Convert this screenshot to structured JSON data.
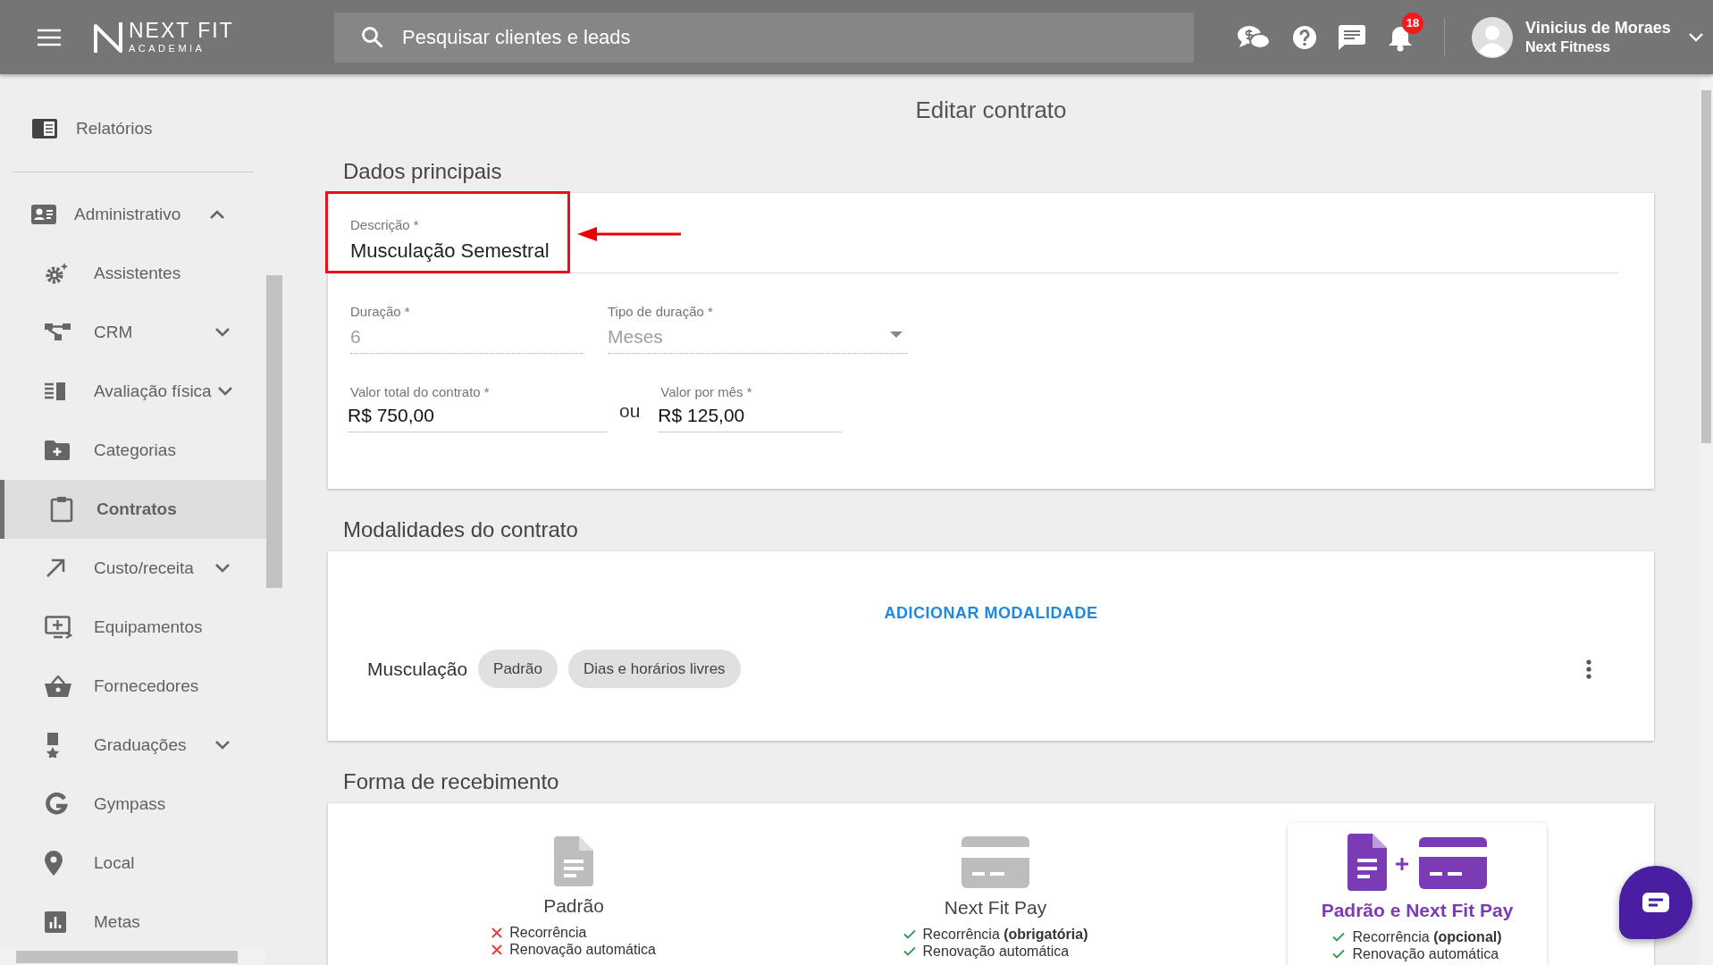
{
  "top_bar": {
    "logo": {
      "name": "NEXT FIT",
      "subtitle": "ACADEMIA"
    },
    "search": {
      "placeholder": "Pesquisar clientes e leads"
    },
    "notification_count": "18",
    "user": {
      "name": "Vinicius de Moraes",
      "company": "Next Fitness"
    }
  },
  "sidebar": {
    "items": [
      {
        "label": "Relatórios",
        "selected": false
      },
      {
        "label": "Administrativo",
        "selected": false,
        "expanded": true,
        "children": [
          {
            "label": "Assistentes",
            "selected": false
          },
          {
            "label": "CRM",
            "selected": false,
            "expanded": false
          },
          {
            "label": "Avaliação física",
            "selected": false,
            "expanded": false
          },
          {
            "label": "Categorias",
            "selected": false
          },
          {
            "label": "Contratos",
            "selected": true
          },
          {
            "label": "Custo/receita",
            "selected": false,
            "expanded": false
          },
          {
            "label": "Equipamentos",
            "selected": false
          },
          {
            "label": "Fornecedores",
            "selected": false
          },
          {
            "label": "Graduações",
            "selected": false,
            "expanded": false
          },
          {
            "label": "Gympass",
            "selected": false
          },
          {
            "label": "Local",
            "selected": false
          },
          {
            "label": "Metas",
            "selected": false
          }
        ]
      }
    ]
  },
  "page_title": "Editar contrato",
  "main_data": {
    "heading": "Dados principais",
    "description": {
      "label": "Descrição *",
      "value": "Musculação Semestral",
      "highlighted": true
    },
    "duration": {
      "label": "Duração *",
      "value": "6",
      "disabled": true
    },
    "duration_type": {
      "label": "Tipo de duração *",
      "value": "Meses",
      "disabled": true
    },
    "total_value": {
      "label": "Valor total do contrato *",
      "value": "R$ 750,00"
    },
    "separator": "ou",
    "monthly_value": {
      "label": "Valor por mês *",
      "value": "R$ 125,00"
    }
  },
  "modalities": {
    "heading": "Modalidades do contrato",
    "add_button": "ADICIONAR MODALIDADE",
    "items": [
      {
        "name": "Musculação",
        "tags": [
          "Padrão",
          "Dias e horários livres"
        ]
      }
    ]
  },
  "payment": {
    "heading": "Forma de recebimento",
    "options": [
      {
        "kind": "standard",
        "title": "Padrão",
        "selected": false,
        "features": [
          {
            "text": "Recorrência",
            "available": false
          },
          {
            "text": "Renovação automática",
            "available": false
          }
        ]
      },
      {
        "kind": "pay",
        "title": "Next Fit Pay",
        "selected": false,
        "features": [
          {
            "text": "Recorrência **(obrigatória)**",
            "available": true
          },
          {
            "text": "Renovação automática",
            "available": true
          }
        ]
      },
      {
        "kind": "both",
        "title": "Padrão e Next Fit Pay",
        "selected": true,
        "features": [
          {
            "text": "Recorrência **(opcional)**",
            "available": true
          },
          {
            "text": "Renovação automática",
            "available": true
          }
        ]
      }
    ]
  }
}
